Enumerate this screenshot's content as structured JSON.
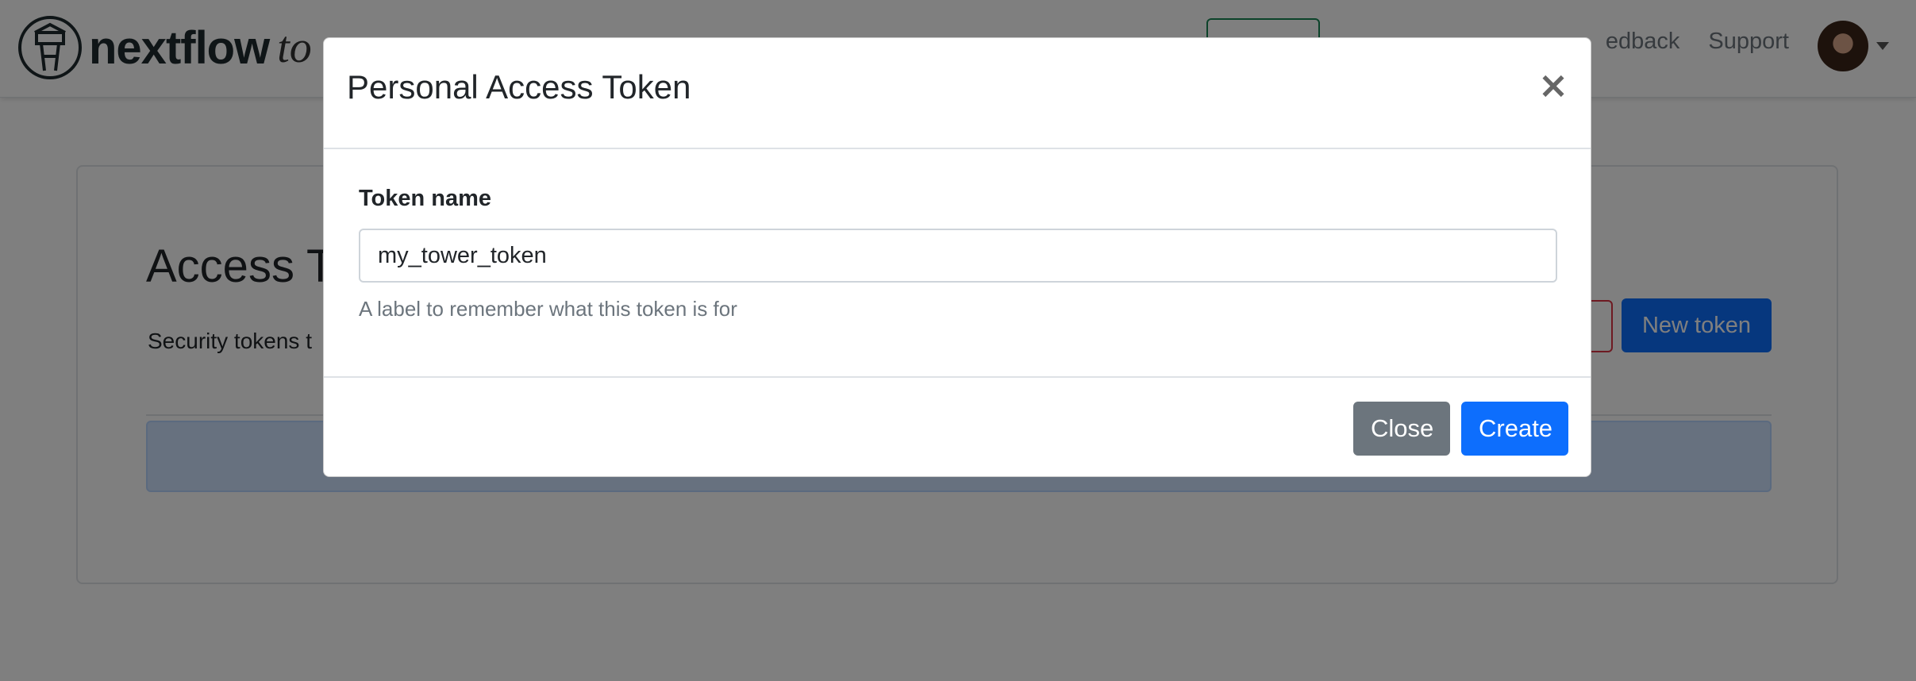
{
  "navbar": {
    "brand": "nextflow",
    "brand_sub": "to",
    "links": [
      "edback",
      "Support"
    ]
  },
  "card": {
    "title": "Access T",
    "description": "Security tokens t",
    "new_token_label": "New token"
  },
  "modal": {
    "title": "Personal Access Token",
    "close_symbol": "×",
    "field_label": "Token name",
    "field_value": "my_tower_token",
    "help_text": "A label to remember what this token is for",
    "close_button": "Close",
    "create_button": "Create"
  },
  "colors": {
    "primary": "#0d6efd",
    "secondary": "#6c757d",
    "danger": "#dc3545",
    "success": "#198754"
  }
}
